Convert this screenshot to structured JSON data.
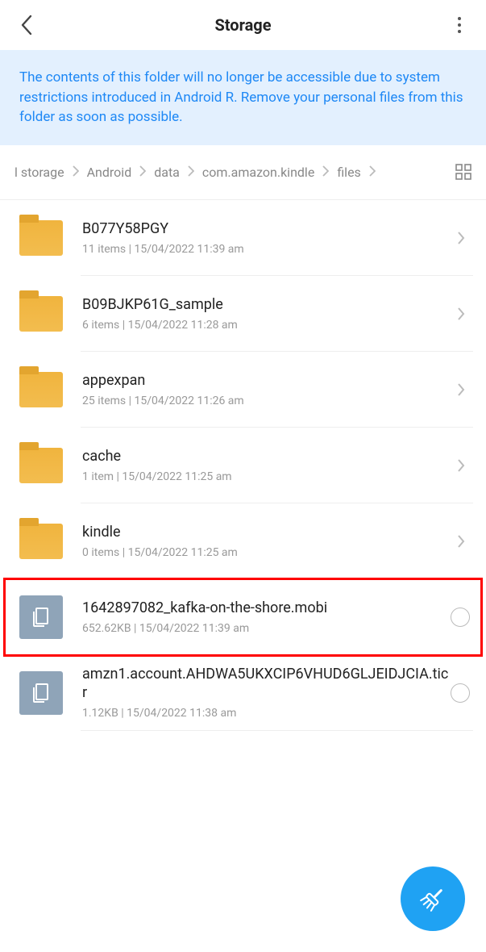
{
  "header": {
    "title": "Storage"
  },
  "banner": {
    "text": "The contents of this folder will no longer be accessible due to system restrictions introduced in Android R. Remove your personal files from this folder as soon as possible."
  },
  "breadcrumb": {
    "items": [
      {
        "label": "l storage"
      },
      {
        "label": "Android"
      },
      {
        "label": "data"
      },
      {
        "label": "com.amazon.kindle"
      },
      {
        "label": "files"
      }
    ]
  },
  "items": [
    {
      "kind": "folder",
      "name": "B077Y58PGY",
      "meta": "11 items  |  15/04/2022 11:39 am"
    },
    {
      "kind": "folder",
      "name": "B09BJKP61G_sample",
      "meta": "6 items  |  15/04/2022 11:28 am"
    },
    {
      "kind": "folder",
      "name": "appexpan",
      "meta": "25 items  |  15/04/2022 11:26 am"
    },
    {
      "kind": "folder",
      "name": "cache",
      "meta": "1 item  |  15/04/2022 11:25 am"
    },
    {
      "kind": "folder",
      "name": "kindle",
      "meta": "0 items  |  15/04/2022 11:25 am"
    },
    {
      "kind": "file",
      "name": "1642897082_kafka-on-the-shore.mobi",
      "meta": "652.62KB  |  15/04/2022 11:39 am",
      "highlighted": true
    },
    {
      "kind": "file",
      "name": "amzn1.account.AHDWA5UKXCIP6VHUD6GLJEIDJCIA.ticr",
      "meta": "1.12KB  |  15/04/2022 11:38 am"
    }
  ]
}
